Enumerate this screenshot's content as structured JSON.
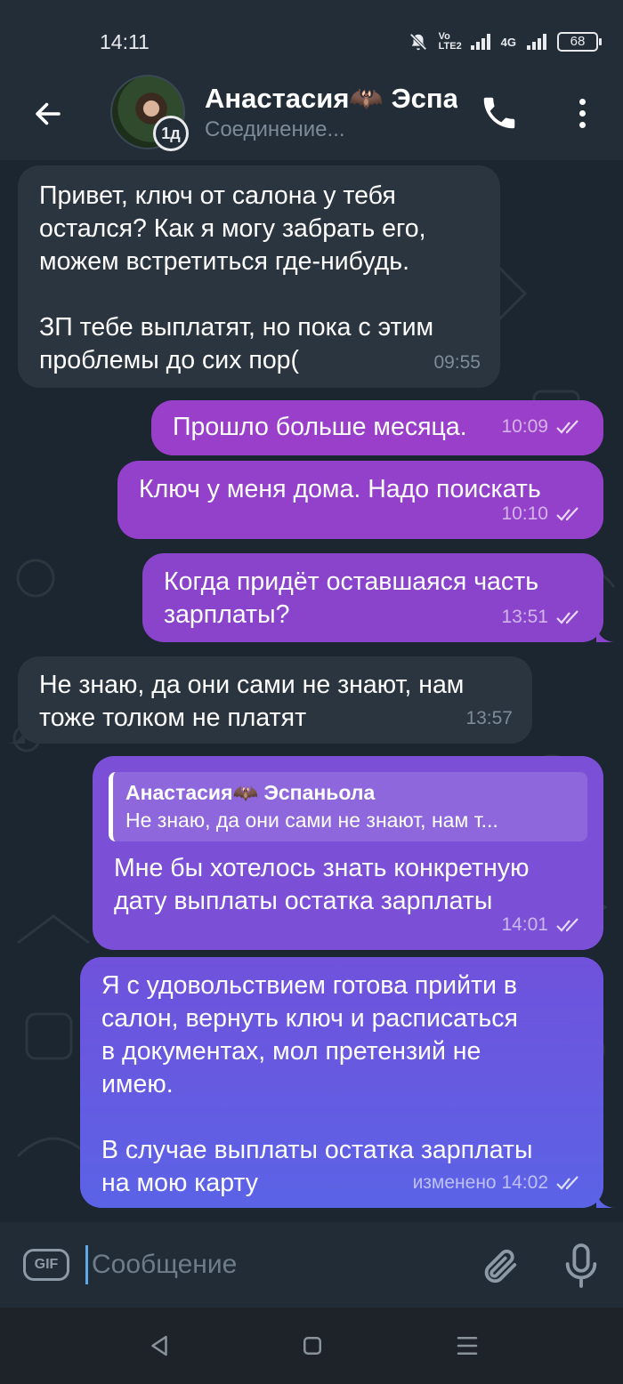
{
  "status_bar": {
    "time": "14:11",
    "network_label": "Vo LTE2",
    "network_type": "4G",
    "battery": "68"
  },
  "header": {
    "chat_title": "Анастасия🦇 Эспаньола",
    "chat_subtitle": "Соединение...",
    "story_badge": "1д"
  },
  "messages": [
    {
      "direction": "in",
      "text": "Привет, ключ от салона у тебя\nостался? Как я могу забрать его,\nможем встретиться где-нибудь.\n\nЗП тебе выплатят, но пока с этим\nпроблемы до сих пор(",
      "time": "09:55"
    },
    {
      "direction": "out",
      "text": "Прошло больше месяца.",
      "time": "10:09"
    },
    {
      "direction": "out",
      "text": "Ключ у меня дома. Надо поискать",
      "time": "10:10"
    },
    {
      "direction": "out",
      "text": "Когда придёт оставшаяся часть\nзарплаты?",
      "time": "13:51"
    },
    {
      "direction": "in",
      "text": "Не знаю, да они сами не знают, нам\nтоже толком не платят",
      "time": "13:57"
    },
    {
      "direction": "out",
      "reply_name": "Анастасия🦇 Эспаньола",
      "reply_text": "Не знаю, да они сами не знают, нам т...",
      "text": "Мне бы хотелось знать конкретную\nдату выплаты остатка зарплаты",
      "time": "14:01"
    },
    {
      "direction": "out",
      "text": "Я с удовольствием готова прийти в\nсалон, вернуть ключ и расписаться\nв документах, мол претензий не\nимею.\n\nВ случае выплаты остатка зарплаты\nна мою карту",
      "time": "изменено 14:02"
    }
  ],
  "input": {
    "gif_label": "GIF",
    "placeholder": "Сообщение"
  },
  "colors": {
    "header_bg": "#222d37",
    "chat_bg": "#1b2630",
    "incoming_bubble": "#2a3540",
    "outgoing_bubble_top": "#9a3fc9",
    "outgoing_bubble_bottom": "#5b63e6"
  },
  "icons": {
    "back": "arrow-left-icon",
    "call": "phone-icon",
    "menu": "more-vertical-icon",
    "attach": "paperclip-icon",
    "mic": "microphone-icon",
    "read": "double-check-icon"
  }
}
